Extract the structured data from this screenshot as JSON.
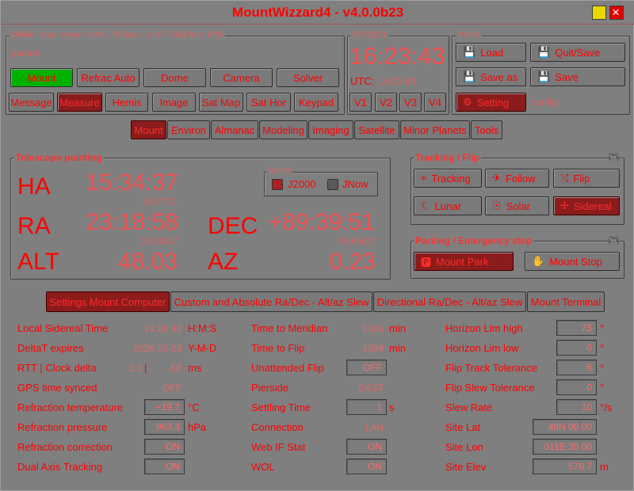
{
  "window": {
    "title": "MountWizzard4 - v4.0.0b23"
  },
  "colors": {
    "accent": "#ff0000",
    "selected": "#8c1c1c",
    "green": "#00b000",
    "background": "#808080"
  },
  "status": {
    "line": "Online - Day - Moon: 6.0% - Threads: 4 / 30 - Disk free: 87%",
    "state": "parked"
  },
  "device_buttons": [
    "Mount",
    "Refrac Auto",
    "Dome",
    "Camera",
    "Solver"
  ],
  "window_buttons": [
    "Message",
    "Measure",
    "Hemis",
    "Image",
    "Sat Map",
    "Sat Hor",
    "Keypad"
  ],
  "time": {
    "tz_label": "TZ: CEST",
    "clock": "16:23:43",
    "utc_label": "UTC:",
    "utc_value": "16:23:43",
    "v_buttons": [
      "V1",
      "V2",
      "V3",
      "V4"
    ]
  },
  "profile": {
    "label": "Profile",
    "load": "Load",
    "quit_save": "Quit/Save",
    "save_as": "Save as",
    "save": "Save",
    "setting": "Setting",
    "config": "config"
  },
  "main_tabs": [
    "Mount",
    "Environ",
    "Almanac",
    "Modeling",
    "Imaging",
    "Satellite",
    "Minor Planets",
    "Tools"
  ],
  "pointing": {
    "label": "Telescope pointing",
    "epoch_label": "Epoch",
    "j2000": "J2000",
    "jnow": "JNow",
    "ha_label": "HA",
    "ha": "15:34:37",
    "ha_dec": "15.57711",
    "ra_label": "RA",
    "ra": "23:18:58",
    "ra_dec": "23.31627",
    "dec_label": "DEC",
    "dec": "+89:39:51",
    "dec_dec": "89.66427",
    "alt_label": "ALT",
    "alt": "48.03",
    "az_label": "AZ",
    "az": "0.23"
  },
  "tracking": {
    "label": "Tracking / Flip",
    "tracking": "Tracking",
    "follow": "Follow",
    "flip": "Flip",
    "lunar": "Lunar",
    "solar": "Solar",
    "sidereal": "Sidereal"
  },
  "parking": {
    "label": "Parking / Emergency stop",
    "park": "Mount Park",
    "stop": "Mount Stop"
  },
  "sub_tabs": [
    "Settings Mount Computer",
    "Custom and Absolute Ra/Dec - Alt/az Slew",
    "Directional Ra/Dec - Alt/az Slew",
    "Mount Terminal"
  ],
  "settings": {
    "col1": [
      {
        "label": "Local Sidereal Time",
        "value": "14:26:42",
        "unit": "H:M:S"
      },
      {
        "label": "DeltaT expires",
        "value": "2026-10-23",
        "unit": "Y-M-D"
      },
      {
        "label": "RTT |  Clock delta",
        "value": "1.0",
        "sep": "|",
        "value2": "-58",
        "unit": "ms"
      },
      {
        "label": "GPS time synced",
        "value": "OFF"
      },
      {
        "label": "Refraction temperature",
        "value": "+19.7",
        "unit": "°C"
      },
      {
        "label": "Refraction pressure",
        "value": "963.3",
        "unit": "hPa"
      },
      {
        "label": "Refraction correction",
        "value": "ON"
      },
      {
        "label": "Dual Axis Tracking",
        "value": "ON"
      }
    ],
    "col2": [
      {
        "label": "Time to Meridian",
        "value": "1365",
        "unit": "min"
      },
      {
        "label": "Time to Flip",
        "value": "1389",
        "unit": "min"
      },
      {
        "label": "Unattended Flip",
        "value": "OFF"
      },
      {
        "label": "Pierside",
        "value": "EAST"
      },
      {
        "label": "Settling Time",
        "value": "1",
        "unit": "s"
      },
      {
        "label": "Connection",
        "value": "LAN"
      },
      {
        "label": "Web IF Stat",
        "value": "ON"
      },
      {
        "label": "WOL",
        "value": "ON"
      }
    ],
    "col3": [
      {
        "label": "Horizon Lim high",
        "value": "75",
        "unit": "°"
      },
      {
        "label": "Horizon Lim low",
        "value": "0",
        "unit": "°"
      },
      {
        "label": "Flip Track Tolerance",
        "value": "6",
        "unit": "°"
      },
      {
        "label": "Flip Slew Tolerance",
        "value": "0",
        "unit": "°"
      },
      {
        "label": "Slew Rate",
        "value": "10",
        "unit": "°/s"
      },
      {
        "label": "Site Lat",
        "value": "48N 08 00"
      },
      {
        "label": "Site Lon",
        "value": "011E 35 00"
      },
      {
        "label": "Site Elev",
        "value": "570.7",
        "unit": "m"
      }
    ]
  }
}
